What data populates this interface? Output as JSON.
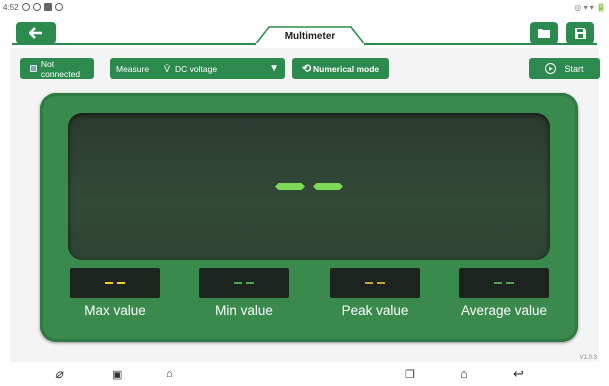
{
  "status_bar": {
    "time": "4:52",
    "right": "◎ ▾ ▾ 🔋"
  },
  "header": {
    "title": "Multimeter"
  },
  "toolbar": {
    "connection": "Not connected",
    "measure_label": "Measure",
    "measure_value": "DC voltage",
    "mode_label": "Numerical mode",
    "start_label": "Start"
  },
  "display": {
    "reading": "--"
  },
  "stats": [
    {
      "label": "Max value",
      "color": "#f2d21e"
    },
    {
      "label": "Min value",
      "color": "#4aa84a"
    },
    {
      "label": "Peak value",
      "color": "#c8a43a"
    },
    {
      "label": "Average value",
      "color": "#4aa84a"
    }
  ],
  "version": "V1.0.3",
  "icons": {
    "back": "back-arrow-icon",
    "folder": "folder-icon",
    "save": "save-icon",
    "dc_symbol": "dc-voltage-symbol-icon",
    "dropdown": "caret-down-icon",
    "mode": "refresh-icon",
    "start": "play-circle-icon"
  },
  "colors": {
    "accent": "#2d8a4e",
    "display_green": "#7ed957"
  }
}
